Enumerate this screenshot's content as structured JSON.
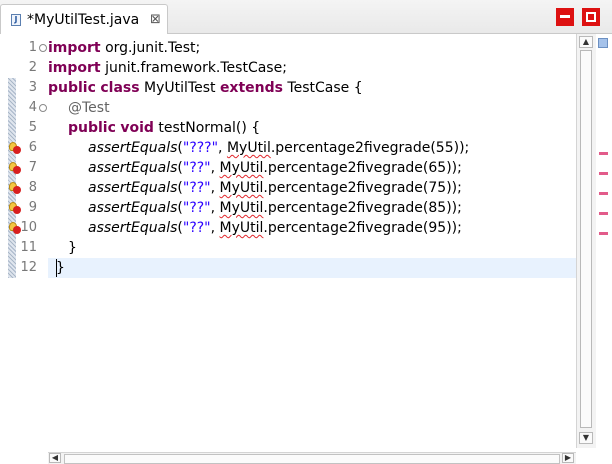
{
  "tab": {
    "title": "*MyUtilTest.java",
    "file_icon": "java-file-icon",
    "file_icon_letter": "J",
    "close_glyph": "⊠"
  },
  "window_controls": {
    "minimize": "minimize-icon",
    "maximize": "maximize-icon",
    "color": "#dd1111"
  },
  "colors": {
    "keyword": "#7f0055",
    "string": "#2a00ff",
    "annotation": "#646464",
    "error_underline": "#e0262b",
    "current_line": "#e8f2fe"
  },
  "scrollbar": {
    "up_arrow": "▲",
    "down_arrow": "▼",
    "left_arrow": "◀",
    "right_arrow": "▶"
  },
  "editor": {
    "current_line": 12,
    "lines": [
      {
        "n": "1",
        "fold": "⊖",
        "error": false,
        "kw1": "import",
        "text": " org.junit.Test;"
      },
      {
        "n": "2",
        "error": false,
        "kw1": "import",
        "text": " junit.framework.TestCase;"
      },
      {
        "n": "3",
        "error": false,
        "kw1": "public",
        "sp1": " ",
        "kw2": "class",
        "mid": " MyUtilTest ",
        "kw3": "extends",
        "text": " TestCase {"
      },
      {
        "n": "4",
        "fold": "⊖",
        "error": false,
        "ann": "@Test"
      },
      {
        "n": "5",
        "error": false,
        "kw1": "public",
        "sp1": " ",
        "kw2": "void",
        "text": " testNormal() {"
      },
      {
        "n": "6",
        "error": true,
        "call": "assertEquals",
        "open": "(",
        "str": "\"???\"",
        "sep": ", ",
        "cls": "MyUtil",
        "rest": ".percentage2fivegrade(55));"
      },
      {
        "n": "7",
        "error": true,
        "call": "assertEquals",
        "open": "(",
        "str": "\"??\"",
        "sep": ", ",
        "cls": "MyUtil",
        "rest": ".percentage2fivegrade(65));"
      },
      {
        "n": "8",
        "error": true,
        "call": "assertEquals",
        "open": "(",
        "str": "\"??\"",
        "sep": ", ",
        "cls": "MyUtil",
        "rest": ".percentage2fivegrade(75));"
      },
      {
        "n": "9",
        "error": true,
        "call": "assertEquals",
        "open": "(",
        "str": "\"??\"",
        "sep": ", ",
        "cls": "MyUtil",
        "rest": ".percentage2fivegrade(85));"
      },
      {
        "n": "10",
        "error": true,
        "call": "assertEquals",
        "open": "(",
        "str": "\"??\"",
        "sep": ", ",
        "cls": "MyUtil",
        "rest": ".percentage2fivegrade(95));"
      },
      {
        "n": "11",
        "error": false,
        "text": "}"
      },
      {
        "n": "12",
        "error": false,
        "text": "}"
      }
    ]
  }
}
